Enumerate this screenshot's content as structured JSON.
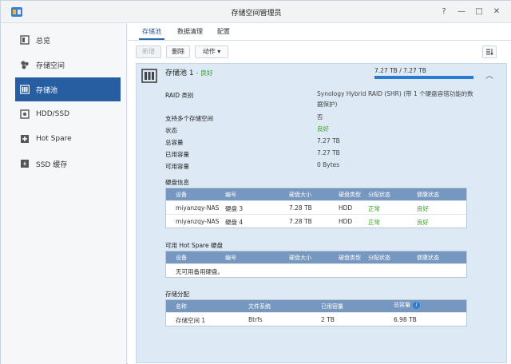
{
  "window": {
    "title": "存储空间管理员",
    "controls": [
      "?",
      "—",
      "□",
      "✕"
    ]
  },
  "sidebar": {
    "items": [
      {
        "label": "总览",
        "icon": "overview-icon",
        "active": false
      },
      {
        "label": "存储空间",
        "icon": "volume-icon",
        "active": false
      },
      {
        "label": "存储池",
        "icon": "storage-pool-icon",
        "active": true
      },
      {
        "label": "HDD/SSD",
        "icon": "drive-icon",
        "active": false
      },
      {
        "label": "Hot Spare",
        "icon": "hot-spare-icon",
        "active": false
      },
      {
        "label": "SSD 缓存",
        "icon": "ssd-cache-icon",
        "active": false
      }
    ]
  },
  "tabs": [
    {
      "label": "存储池",
      "active": true
    },
    {
      "label": "数据清理",
      "active": false
    },
    {
      "label": "配置",
      "active": false
    }
  ],
  "toolbar": {
    "create_label": "新增",
    "delete_label": "删除",
    "action_label": "动作 ▾",
    "sort_icon": "sort-icon"
  },
  "pool": {
    "title": "存储池 1",
    "status": "- 良好",
    "capacity_text": "7.27 TB / 7.27 TB",
    "capacity_fraction": 1.0,
    "properties": [
      {
        "label": "RAID 类别",
        "value": "Synology Hybrid RAID (SHR) (带 1 个硬盘容错功能的数据保护)",
        "status": false
      },
      {
        "label": "支持多个存储空间",
        "value": "否",
        "status": false
      },
      {
        "label": "状态",
        "value": "良好",
        "status": true
      },
      {
        "label": "总容量",
        "value": "7.27 TB",
        "status": false
      },
      {
        "label": "已用容量",
        "value": "7.27 TB",
        "status": false
      },
      {
        "label": "可用容量",
        "value": "0 Bytes",
        "status": false
      }
    ]
  },
  "disk_info": {
    "title": "硬盘信息",
    "headers": [
      "设备",
      "编号",
      "硬盘大小",
      "硬盘类型",
      "分配状态",
      "健康状态"
    ],
    "rows": [
      [
        "miyanzqy-NAS",
        "硬盘 3",
        "7.28 TB",
        "HDD",
        "正常",
        "良好"
      ],
      [
        "miyanzqy-NAS",
        "硬盘 4",
        "7.28 TB",
        "HDD",
        "正常",
        "良好"
      ]
    ]
  },
  "hot_spare": {
    "title": "可用 Hot Spare 硬盘",
    "headers": [
      "设备",
      "编号",
      "硬盘大小",
      "硬盘类型",
      "分配状态",
      "健康状态"
    ],
    "empty_text": "无可用备用硬盘。"
  },
  "allocation": {
    "title": "存储分配",
    "headers": [
      "名称",
      "文件系统",
      "已用容量",
      "总容量"
    ],
    "rows": [
      [
        "存储空间 1",
        "Btrfs",
        "2 TB",
        "6.98 TB"
      ]
    ]
  },
  "colors": {
    "accent": "#275ea2",
    "good": "#3b9d2a",
    "panel": "#ddeaf6",
    "table_header": "#7698c0"
  }
}
